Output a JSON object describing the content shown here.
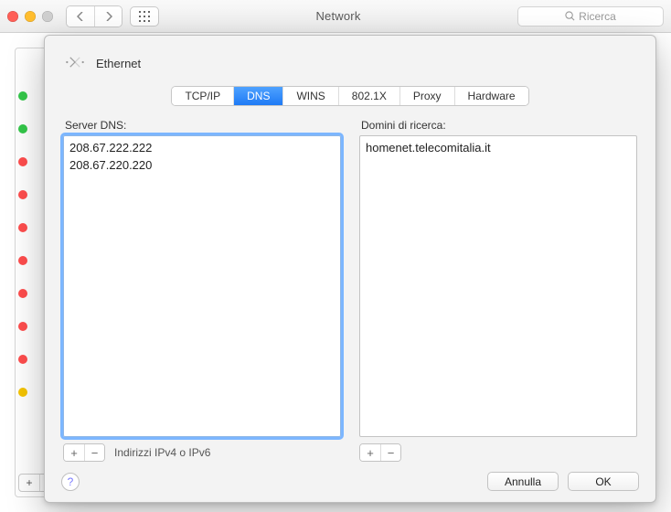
{
  "window": {
    "title": "Network",
    "search_placeholder": "Ricerca"
  },
  "sheet": {
    "connection_name": "Ethernet",
    "tabs": [
      "TCP/IP",
      "DNS",
      "WINS",
      "802.1X",
      "Proxy",
      "Hardware"
    ],
    "active_tab_index": 1,
    "dns": {
      "servers_label": "Server DNS:",
      "servers": [
        "208.67.222.222",
        "208.67.220.220"
      ],
      "servers_hint": "Indirizzi IPv4 o IPv6",
      "domains_label": "Domini di ricerca:",
      "domains": [
        "homenet.telecomitalia.it"
      ]
    },
    "buttons": {
      "cancel": "Annulla",
      "ok": "OK"
    }
  },
  "sidebar_status": [
    "green",
    "green",
    "red",
    "red",
    "red",
    "red",
    "red",
    "red",
    "red",
    "yellow"
  ]
}
